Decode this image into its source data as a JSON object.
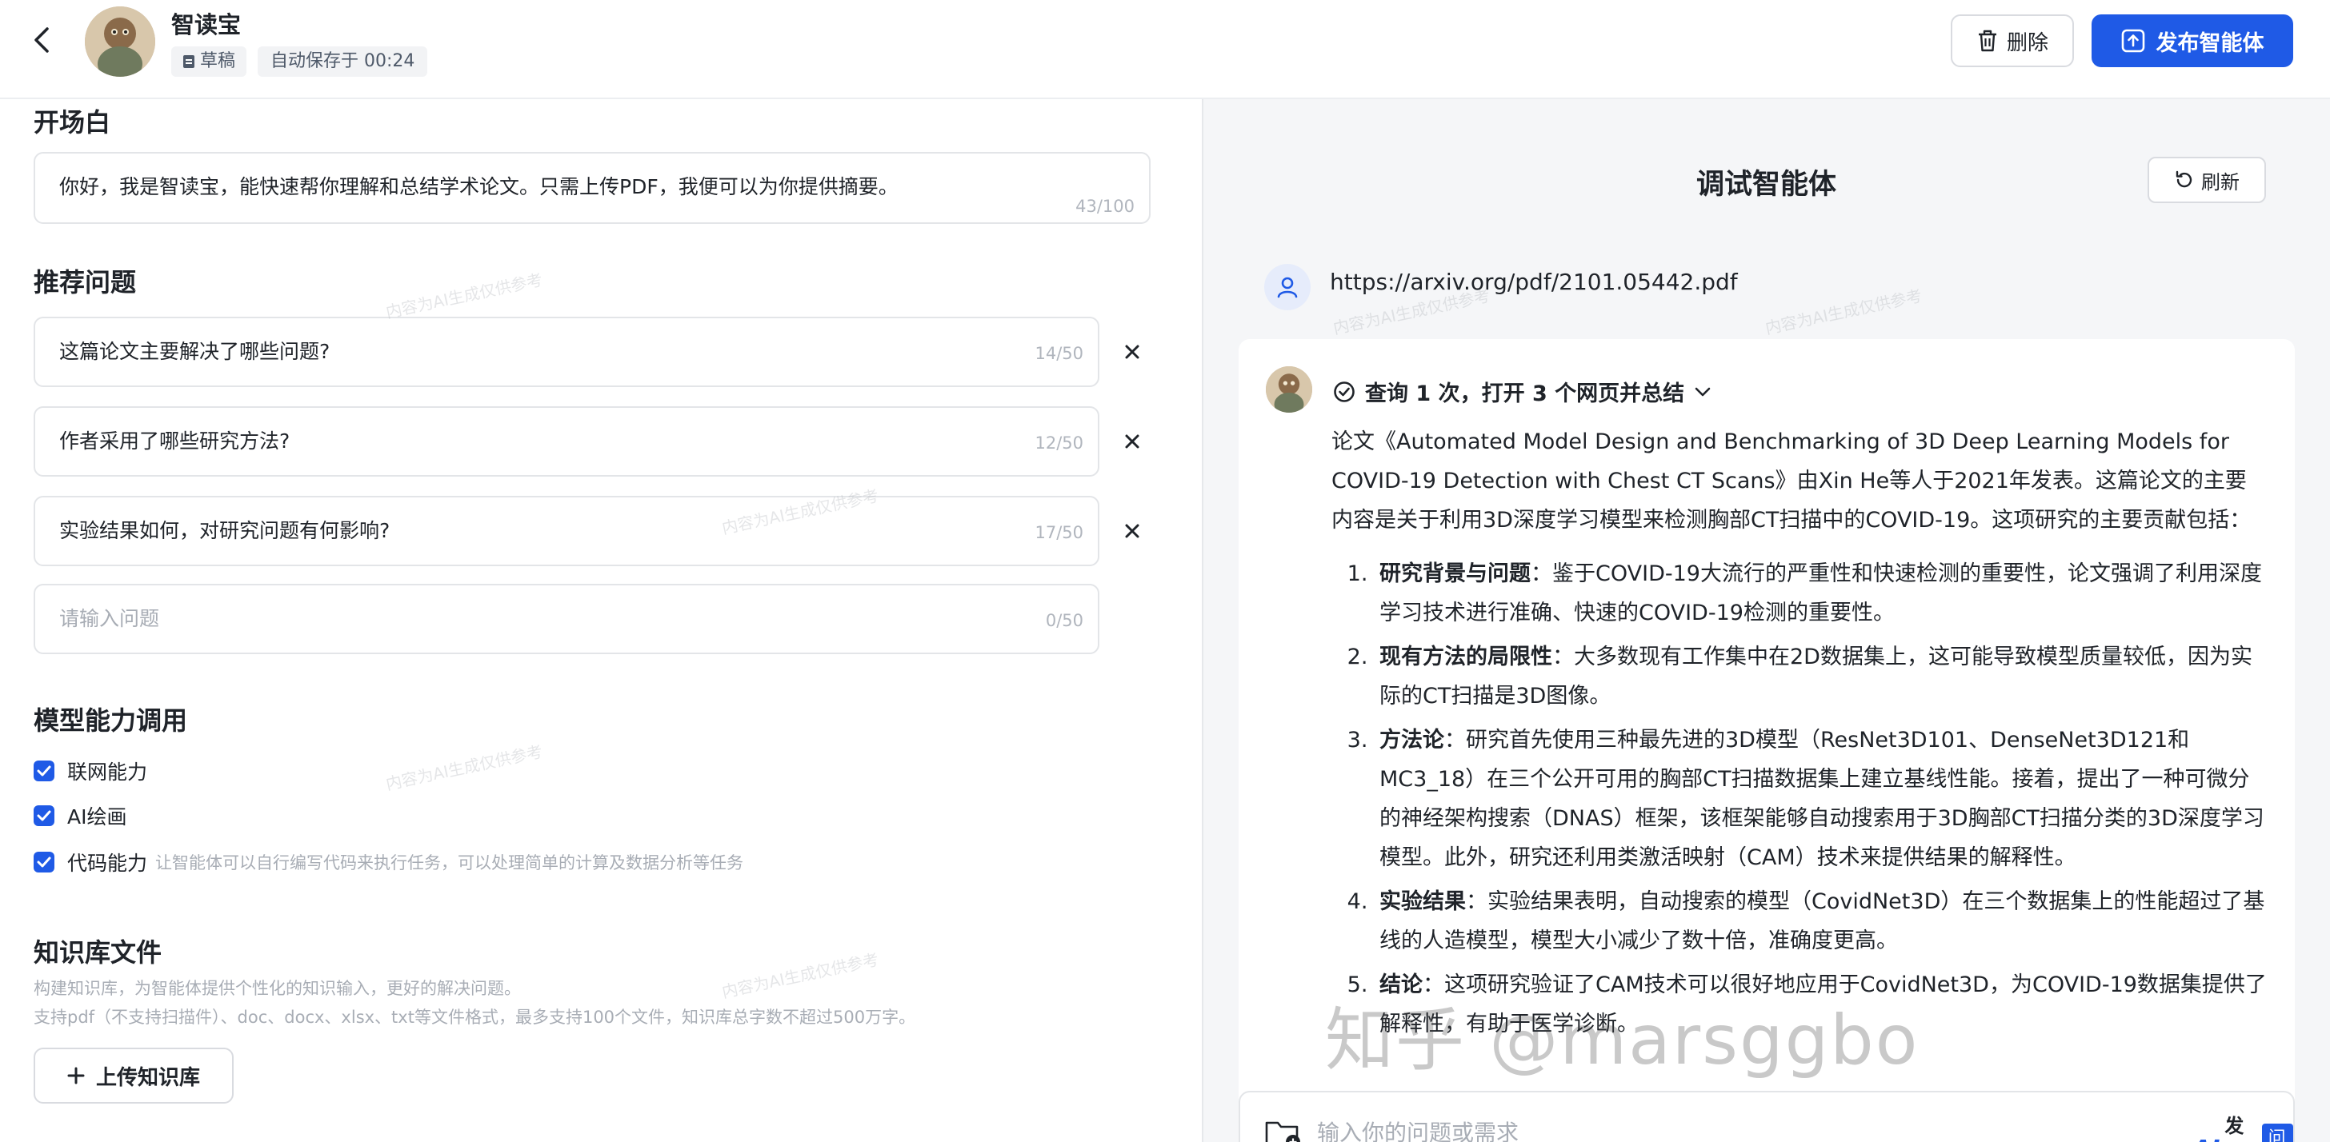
{
  "header": {
    "title": "智读宝",
    "draft_label": "草稿",
    "autosave_label": "自动保存于 00:24",
    "delete_label": "删除",
    "publish_label": "发布智能体"
  },
  "opening": {
    "title": "开场白",
    "text": "你好，我是智读宝，能快速帮你理解和总结学术论文。只需上传PDF，我便可以为你提供摘要。",
    "count": "43/100"
  },
  "questions": {
    "title": "推荐问题",
    "items": [
      {
        "text": "这篇论文主要解决了哪些问题?",
        "count": "14/50"
      },
      {
        "text": "作者采用了哪些研究方法?",
        "count": "12/50"
      },
      {
        "text": "实验结果如何，对研究问题有何影响?",
        "count": "17/50"
      }
    ],
    "new_placeholder": "请输入问题",
    "new_count": "0/50"
  },
  "capabilities": {
    "title": "模型能力调用",
    "items": [
      {
        "label": "联网能力",
        "desc": "",
        "checked": true
      },
      {
        "label": "AI绘画",
        "desc": "",
        "checked": true
      },
      {
        "label": "代码能力",
        "desc": "让智能体可以自行编写代码来执行任务，可以处理简单的计算及数据分析等任务",
        "checked": true
      }
    ]
  },
  "knowledge": {
    "title": "知识库文件",
    "desc1": "构建知识库，为智能体提供个性化的知识输入，更好的解决问题。",
    "desc2": "支持pdf（不支持扫描件）、doc、docx、xlsx、txt等文件格式，最多支持100个文件，知识库总字数不超过500万字。",
    "upload_label": "上传知识库"
  },
  "debug": {
    "title": "调试智能体",
    "refresh_label": "刷新",
    "user_message": "https://arxiv.org/pdf/2101.05442.pdf",
    "search_status": "查询 1 次，打开 3 个网页并总结",
    "intro": "论文《Automated Model Design and Benchmarking of 3D Deep Learning Models for COVID-19 Detection with Chest CT Scans》由Xin He等人于2021年发表。这篇论文的主要内容是关于利用3D深度学习模型来检测胸部CT扫描中的COVID-19。这项研究的主要贡献包括：",
    "points": [
      {
        "head": "研究背景与问题",
        "body": "：鉴于COVID-19大流行的严重性和快速检测的重要性，论文强调了利用深度学习技术进行准确、快速的COVID-19检测的重要性。"
      },
      {
        "head": "现有方法的局限性",
        "body": "：大多数现有工作集中在2D数据集上，这可能导致模型质量较低，因为实际的CT扫描是3D图像。"
      },
      {
        "head": "方法论",
        "body": "：研究首先使用三种最先进的3D模型（ResNet3D101、DenseNet3D121和MC3_18）在三个公开可用的胸部CT扫描数据集上建立基线性能。接着，提出了一种可微分的神经架构搜索（DNAS）框架，该框架能够自动搜索用于3D胸部CT扫描分类的3D深度学习模型。此外，研究还利用类激活映射（CAM）技术来提供结果的解释性。"
      },
      {
        "head": "实验结果",
        "body": "：实验结果表明，自动搜索的模型（CovidNet3D）在三个数据集上的性能超过了基线的人造模型，模型大小减少了数十倍，准确度更高。"
      },
      {
        "head": "结论",
        "body": "：这项研究验证了CAM技术可以很好地应用于CovidNet3D，为COVID-19数据集提供了解释性，有助于医学诊断。"
      }
    ],
    "input_placeholder": "输入你的问题或需求"
  },
  "watermark": {
    "main": "知乎 @marsggbo",
    "faint": "内容为AI生成仅供参考"
  },
  "brand": {
    "logo_mark": "AI",
    "logo_text": "发现AI",
    "logo_badge": "问答"
  },
  "colors": {
    "accent": "#1f5ae6",
    "panel_bg": "#f5f6f8"
  }
}
